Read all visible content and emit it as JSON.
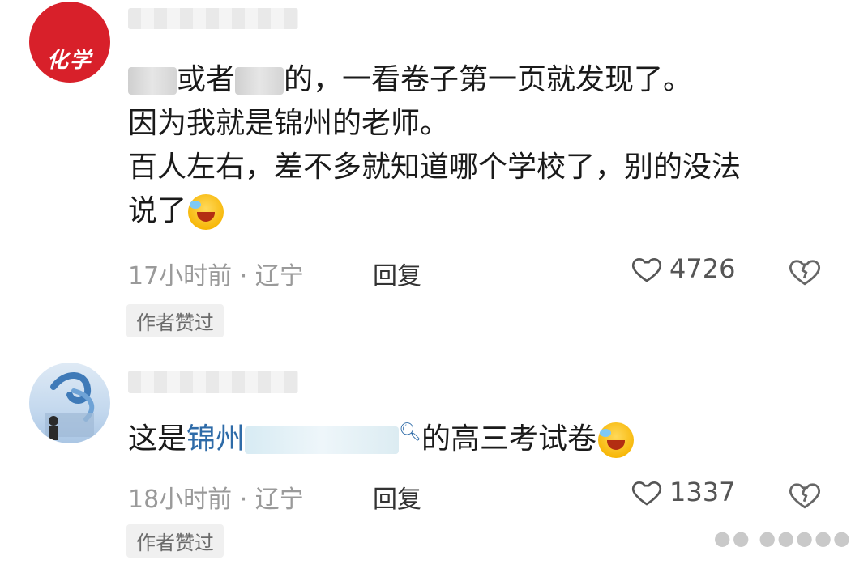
{
  "comments": [
    {
      "avatar_text": "化学",
      "lines": {
        "l1_a": "的，一看卷子第一页就发现了。",
        "l2": "因为我就是锦州的老师。",
        "l3": "百人左右，差不多就知道哪个学校了，别的没法",
        "l4": "说了",
        "or_text": "或者"
      },
      "time": "17小时前 · 辽宁",
      "reply_label": "回复",
      "likes": "4726",
      "badge": "作者赞过"
    },
    {
      "lines": {
        "prefix": "这是",
        "link": "锦州",
        "suffix": "的高三考试卷"
      },
      "time": "18小时前 · 辽宁",
      "reply_label": "回复",
      "likes": "1337",
      "badge": "作者赞过"
    }
  ],
  "icons": {
    "heart": "heart-icon",
    "dislike": "broken-heart-icon",
    "emoji": "laughing-crying-emoji",
    "search": "search-icon"
  },
  "colors": {
    "link": "#2e6ba8",
    "avatar_red": "#d8202a",
    "meta_gray": "#9a9a9a"
  }
}
